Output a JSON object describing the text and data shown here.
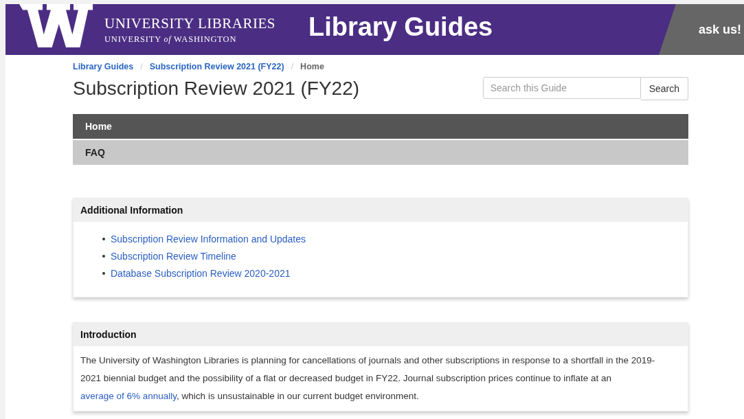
{
  "header": {
    "unit": "UNIVERSITY LIBRARIES",
    "university": "UNIVERSITY",
    "of": "of",
    "washington": "WASHINGTON",
    "title": "Library Guides",
    "ask": "ask us!"
  },
  "breadcrumb_separator": "/",
  "breadcrumbs": [
    {
      "label": "Library Guides",
      "link": true
    },
    {
      "label": "Subscription Review 2021 (FY22)",
      "link": true
    },
    {
      "label": "Home",
      "link": false
    }
  ],
  "page_title": "Subscription Review 2021 (FY22)",
  "search": {
    "placeholder": "Search this Guide",
    "button": "Search"
  },
  "nav": [
    {
      "label": "Home",
      "selected": true
    },
    {
      "label": "FAQ",
      "selected": false
    }
  ],
  "boxes": [
    {
      "title": "Additional Information",
      "kind": "links",
      "links": [
        "Subscription Review Information and Updates",
        "Subscription Review Timeline",
        "Database Subscription Review 2020-2021"
      ]
    },
    {
      "title": "Introduction",
      "kind": "text",
      "before": "The University of Washington Libraries is planning for cancellations of journals and other subscriptions in response to a shortfall in the 2019-2021 biennial budget and the possibility of a flat or decreased budget in FY22. Journal subscription prices continue to inflate at an ",
      "link": "average of 6% annually",
      "after": ", which is unsustainable in our current budget environment."
    }
  ]
}
